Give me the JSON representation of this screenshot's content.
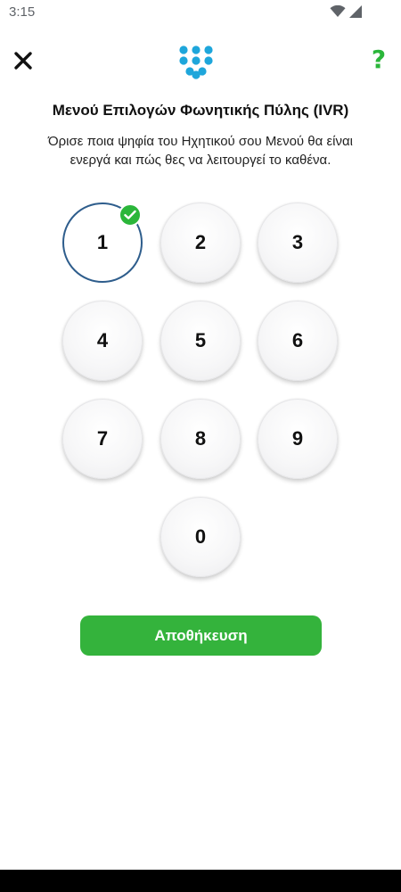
{
  "status_bar": {
    "time": "3:15",
    "icons": [
      "wifi-icon",
      "cellular-signal-icon"
    ]
  },
  "header": {
    "close_icon": "close-icon",
    "logo_icon": "keypad-logo-icon",
    "help_label": "?",
    "accent_color": "#2bb63a"
  },
  "title": "Μενού Επιλογών Φωνητικής Πύλης (IVR)",
  "subtitle": "Όρισε ποια ψηφία του Ηχητικού σου Μενού θα είναι ενεργά και πώς θες να λειτουργεί το καθένα.",
  "keypad": {
    "keys": [
      "1",
      "2",
      "3",
      "4",
      "5",
      "6",
      "7",
      "8",
      "9",
      "0"
    ],
    "selected": [
      "1"
    ],
    "selected_border_color": "#2e5d8c"
  },
  "save_button": {
    "label": "Αποθήκευση",
    "color": "#34b33c"
  }
}
